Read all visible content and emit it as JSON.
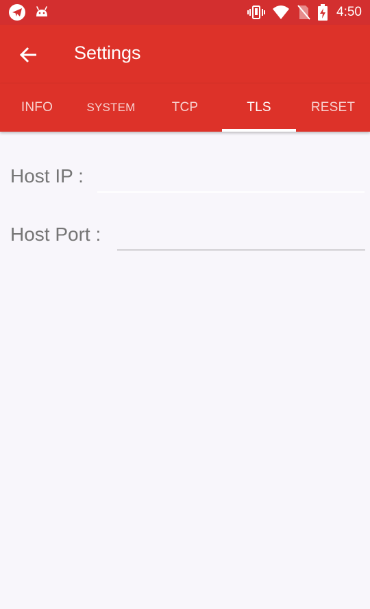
{
  "status_bar": {
    "time": "4:50",
    "left_icons": [
      "airmail-app-icon",
      "android-icon"
    ],
    "right_icons": [
      "vibrate-icon",
      "wifi-icon",
      "no-sim-icon",
      "battery-charging-icon"
    ]
  },
  "app_bar": {
    "title": "Settings",
    "back_icon": "arrow-left-icon"
  },
  "tabs": [
    {
      "label": "INFO",
      "active": false
    },
    {
      "label": "SYSTEM",
      "active": false
    },
    {
      "label": "TCP",
      "active": false
    },
    {
      "label": "TLS",
      "active": true
    },
    {
      "label": "RESET",
      "active": false
    }
  ],
  "form": {
    "host_ip": {
      "label": "Host IP :",
      "value": ""
    },
    "host_port": {
      "label": "Host Port :",
      "value": ""
    }
  },
  "colors": {
    "status_bar": "#d32f2f",
    "primary": "#dd3229",
    "background": "#f8f6fb",
    "label_text": "#757575"
  }
}
